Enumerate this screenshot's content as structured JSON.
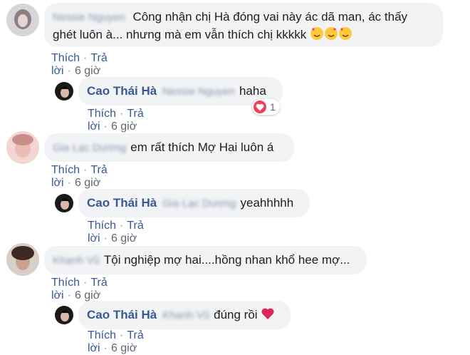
{
  "actions": {
    "like": "Thích",
    "reply": "Trả lời",
    "sep": "·"
  },
  "comments": [
    {
      "author": "Nessie Nguyen",
      "text": "Công nhận chị Hà đóng vai này ác dã man, ác thấy",
      "text2": "ghét luôn à... nhưng mà em vẫn thích chị kkkkk",
      "emoji": "smiling-face-with-hearts",
      "time": "6 giờ"
    },
    {
      "author": "Cao Thái Hà",
      "mention": "Nessie Nguyen",
      "text": "haha",
      "time": "6 giờ",
      "reaction": {
        "type": "love",
        "count": "1"
      }
    },
    {
      "author": "Gia Lạc Dương",
      "text": "em rất thích Mợ Hai luôn á",
      "time": "6 giờ"
    },
    {
      "author": "Cao Thái Hà",
      "mention": "Gia Lạc Dương",
      "text": "yeahhhhh",
      "time": "6 giờ"
    },
    {
      "author": "Khanh Vũ",
      "text": "Tội nghiệp mợ hai....hồng nhan khổ hee mợ...",
      "time": "6 giờ"
    },
    {
      "author": "Cao Thái Hà",
      "mention": "Khanh Vũ",
      "text": "đúng rồi",
      "emoji": "red-heart",
      "time": "6 giờ"
    }
  ],
  "colors": {
    "link": "#385898",
    "bubble": "#f2f3f5",
    "love": "#f33e58"
  }
}
